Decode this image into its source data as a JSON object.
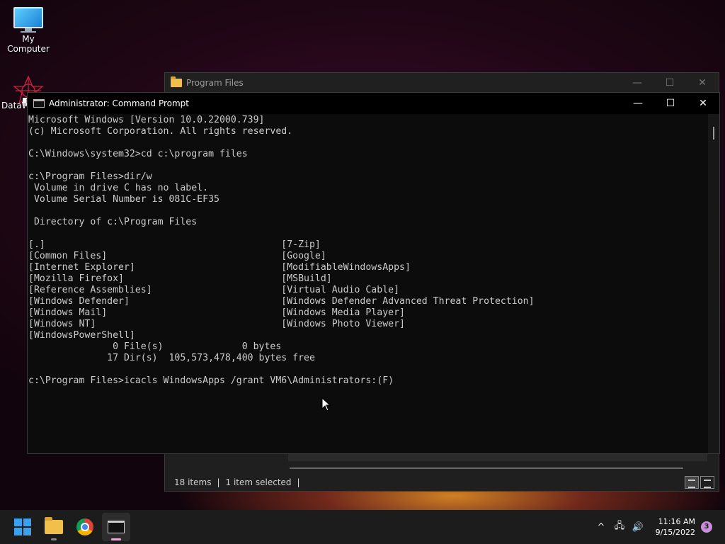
{
  "desktop": {
    "icons": [
      {
        "label": "My Computer",
        "icon": "monitor-icon"
      },
      {
        "label": "DataW",
        "icon": "datawrapper-icon"
      }
    ]
  },
  "explorer": {
    "title": "Program Files",
    "controls": {
      "minimize": "—",
      "maximize": "☐",
      "close": "✕"
    },
    "status": {
      "items": "18 items",
      "selected": "1 item selected",
      "separator": "|"
    }
  },
  "cmd": {
    "title": "Administrator: Command Prompt",
    "controls": {
      "minimize": "—",
      "maximize": "☐",
      "close": "✕"
    },
    "lines": [
      "Microsoft Windows [Version 10.0.22000.739]",
      "(c) Microsoft Corporation. All rights reserved.",
      "",
      "C:\\Windows\\system32>cd c:\\program files",
      "",
      "c:\\Program Files>dir/w",
      " Volume in drive C has no label.",
      " Volume Serial Number is 081C-EF35",
      "",
      " Directory of c:\\Program Files",
      "",
      "[.]                                          [7-Zip]",
      "[Common Files]                               [Google]",
      "[Internet Explorer]                          [ModifiableWindowsApps]",
      "[Mozilla Firefox]                            [MSBuild]",
      "[Reference Assemblies]                       [Virtual Audio Cable]",
      "[Windows Defender]                           [Windows Defender Advanced Threat Protection]",
      "[Windows Mail]                               [Windows Media Player]",
      "[Windows NT]                                 [Windows Photo Viewer]",
      "[WindowsPowerShell]",
      "               0 File(s)              0 bytes",
      "              17 Dir(s)  105,573,478,400 bytes free",
      "",
      "c:\\Program Files>icacls WindowsApps /grant VM6\\Administrators:(F)"
    ]
  },
  "taskbar": {
    "apps": [
      {
        "name": "Start",
        "icon": "windows-logo-icon"
      },
      {
        "name": "File Explorer",
        "icon": "folder-icon"
      },
      {
        "name": "Google Chrome",
        "icon": "chrome-icon"
      },
      {
        "name": "Command Prompt",
        "icon": "terminal-icon"
      }
    ],
    "tray": {
      "chevron": "^",
      "network": "🖧",
      "volume": "🔊",
      "time": "11:16 AM",
      "date": "9/15/2022",
      "notifications": "3"
    }
  },
  "colors": {
    "console_bg": "#0c0c0c",
    "console_text": "#cccccc",
    "taskbar_bg": "#1c1c1c",
    "accent": "#e6a7d8"
  }
}
